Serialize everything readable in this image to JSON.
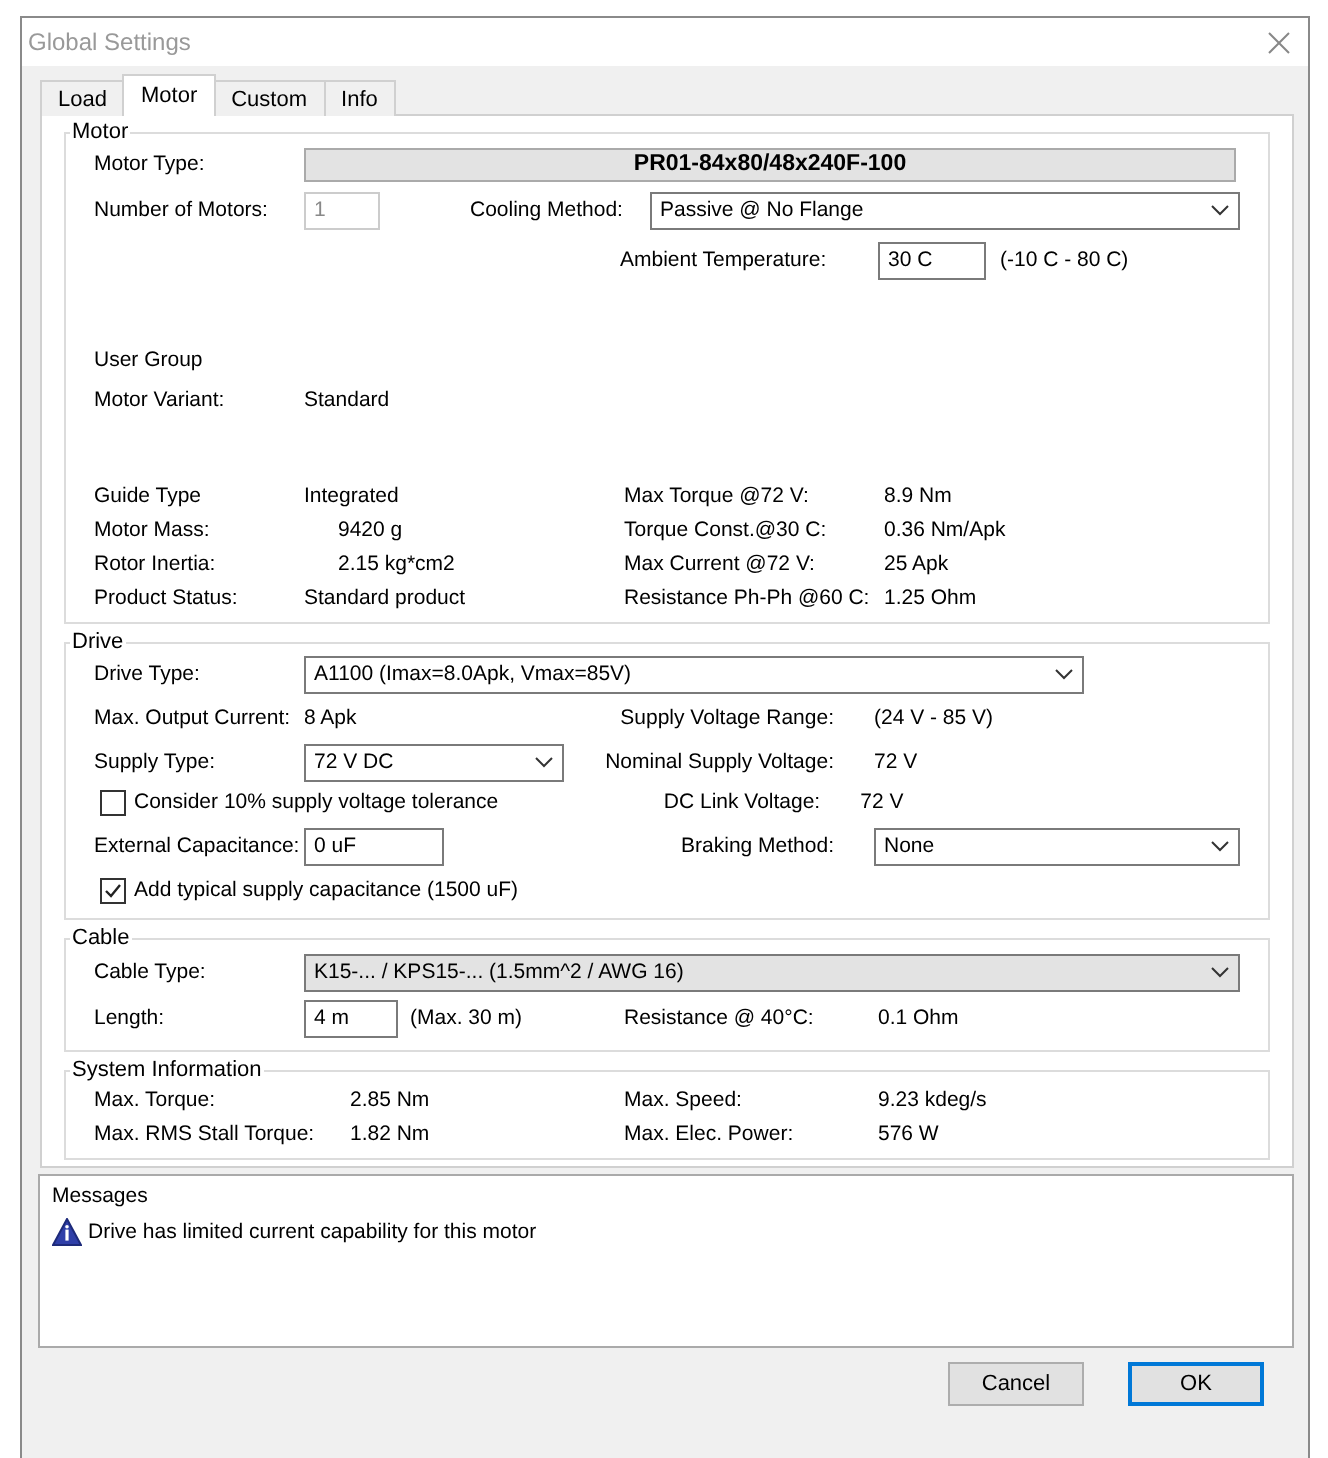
{
  "window": {
    "title": "Global Settings"
  },
  "tabs": [
    {
      "label": "Load",
      "selected": false
    },
    {
      "label": "Motor",
      "selected": true
    },
    {
      "label": "Custom",
      "selected": false
    },
    {
      "label": "Info",
      "selected": false
    }
  ],
  "motor": {
    "title": "Motor",
    "motor_type": {
      "label": "Motor Type:",
      "value": "PR01-84x80/48x240F-100"
    },
    "number_of_motors": {
      "label": "Number of Motors:",
      "value": "1",
      "disabled": true
    },
    "cooling_method": {
      "label": "Cooling Method:",
      "value": "Passive @ No Flange"
    },
    "ambient_temperature": {
      "label": "Ambient Temperature:",
      "value": "30 C",
      "range": "(-10 C - 80 C)"
    },
    "user_group": {
      "label": "User Group"
    },
    "motor_variant": {
      "label": "Motor Variant:",
      "value": "Standard"
    },
    "left_specs": [
      {
        "label": "Guide Type",
        "value": "Integrated",
        "kind": "text"
      },
      {
        "label": "Motor Mass:",
        "value": "9420 g",
        "kind": "number"
      },
      {
        "label": "Rotor Inertia:",
        "value": "2.15 kg*cm2",
        "kind": "number"
      },
      {
        "label": "Product Status:",
        "value": "Standard product",
        "kind": "text"
      }
    ],
    "right_specs": [
      {
        "label": "Max Torque @72 V:",
        "value": "8.9 Nm"
      },
      {
        "label": "Torque Const.@30 C:",
        "value": "0.36 Nm/Apk"
      },
      {
        "label": "Max Current @72 V:",
        "value": "25 Apk"
      },
      {
        "label": "Resistance Ph-Ph @60 C:",
        "value": "1.25 Ohm"
      }
    ]
  },
  "drive": {
    "title": "Drive",
    "drive_type": {
      "label": "Drive Type:",
      "value": "A1100 (Imax=8.0Apk, Vmax=85V)"
    },
    "max_output_current": {
      "label": "Max. Output Current:",
      "value": "8 Apk"
    },
    "supply_voltage_range": {
      "label": "Supply Voltage Range:",
      "value": "(24 V - 85 V)"
    },
    "supply_type": {
      "label": "Supply Type:",
      "value": "72 V DC"
    },
    "nominal_supply_voltage": {
      "label": "Nominal Supply Voltage:",
      "value": "72 V"
    },
    "tolerance": {
      "label": "Consider 10% supply voltage tolerance",
      "checked": false
    },
    "dc_link_voltage": {
      "label": "DC Link Voltage:",
      "value": "72 V"
    },
    "external_capacitance": {
      "label": "External Capacitance:",
      "value": "0 uF"
    },
    "braking_method": {
      "label": "Braking Method:",
      "value": "None"
    },
    "supply_capacitance": {
      "label": "Add typical supply capacitance (1500 uF)",
      "checked": true
    }
  },
  "cable": {
    "title": "Cable",
    "cable_type": {
      "label": "Cable Type:",
      "value": "K15-... / KPS15-... (1.5mm^2 / AWG 16)"
    },
    "length": {
      "label": "Length:",
      "value": "4 m",
      "note": "(Max. 30 m)"
    },
    "resistance": {
      "label": "Resistance @ 40°C:",
      "value": "0.1 Ohm"
    }
  },
  "system_information": {
    "title": "System Information",
    "left": [
      {
        "label": "Max. Torque:",
        "value": "2.85 Nm"
      },
      {
        "label": "Max. RMS Stall Torque:",
        "value": "1.82 Nm"
      }
    ],
    "right": [
      {
        "label": "Max. Speed:",
        "value": "9.23 kdeg/s"
      },
      {
        "label": "Max. Elec. Power:",
        "value": "576 W"
      }
    ]
  },
  "messages": {
    "title": "Messages",
    "items": [
      {
        "kind": "info",
        "text": "Drive has limited current capability for this motor"
      }
    ]
  },
  "buttons": [
    {
      "label": "Cancel",
      "default": false
    },
    {
      "label": "OK",
      "default": true
    }
  ]
}
